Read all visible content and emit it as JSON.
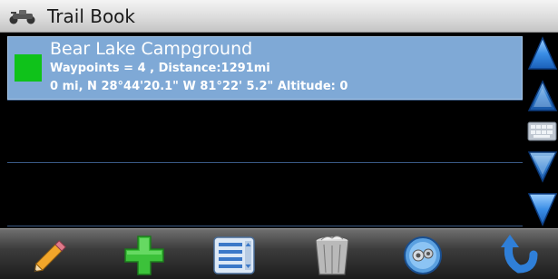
{
  "titlebar": {
    "title": "Trail Book",
    "icon": "atv-icon"
  },
  "trails": [
    {
      "name": "Bear Lake Campground",
      "color": "#0fc21a",
      "selected": true,
      "line1": "Waypoints = 4  , Distance:1291mi",
      "line2": "0 mi, N 28°44'20.1\"  W 81°22' 5.2\" Altitude: 0"
    }
  ],
  "scrollbar": {
    "buttons": [
      "page-up-icon",
      "scroll-up-icon",
      "keyboard-icon",
      "scroll-down-icon",
      "page-down-icon"
    ]
  },
  "toolbar": {
    "buttons": [
      "pencil-icon",
      "add-icon",
      "list-icon",
      "trash-icon",
      "settings-icon",
      "back-icon"
    ]
  },
  "colors": {
    "selected_row": "#7fa9d6",
    "accent_blue": "#2f7fd8",
    "add_green": "#3cc23a"
  }
}
